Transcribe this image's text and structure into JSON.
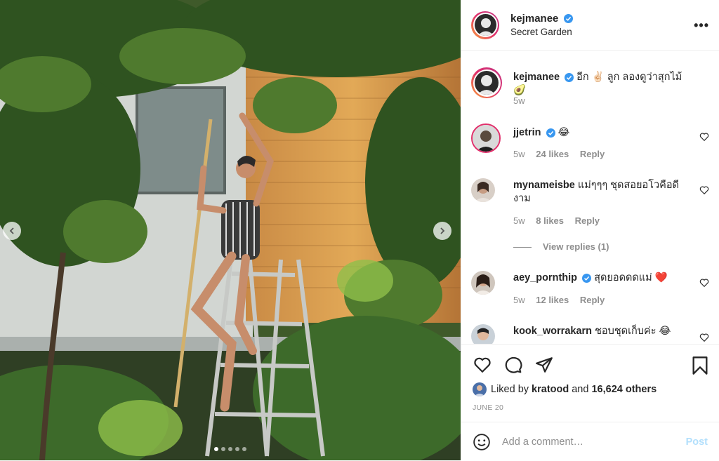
{
  "post": {
    "username": "kejmanee",
    "location": "Secret Garden",
    "more_icon": "more-icon",
    "caption": {
      "username": "kejmanee",
      "text": "อีก ✌🏻 ลูก ลองดูว่าสุกไม้ 🥑",
      "time": "5w"
    },
    "carousel": {
      "slides": 5,
      "active_index": 0
    }
  },
  "comments": [
    {
      "username": "jjetrin",
      "verified": true,
      "text": "😂",
      "time": "5w",
      "likes": "24 likes",
      "reply": "Reply"
    },
    {
      "username": "mynameisbe",
      "verified": false,
      "text": "แม่ๆๆๆ ชุดสอยอโวคือดีงาม",
      "time": "5w",
      "likes": "8 likes",
      "reply": "Reply",
      "view_replies": "View replies (1)"
    },
    {
      "username": "aey_pornthip",
      "verified": true,
      "text": "สุดยอดดดแม่ ❤️",
      "time": "5w",
      "likes": "12 likes",
      "reply": "Reply"
    },
    {
      "username": "kook_worrakarn",
      "verified": false,
      "text": "ชอบชุดเก็บค่ะ 😂",
      "time": "",
      "likes": "",
      "reply": ""
    }
  ],
  "likes": {
    "prefix": "Liked by ",
    "user": "kratood",
    "middle": " and ",
    "others": "16,624 others"
  },
  "date": "JUNE 20",
  "add_comment": {
    "placeholder": "Add a comment…",
    "post_label": "Post"
  },
  "colors": {
    "verified": "#3897f0",
    "post_disabled": "#b2dffc",
    "muted": "#8e8e8e",
    "text": "#262626"
  }
}
